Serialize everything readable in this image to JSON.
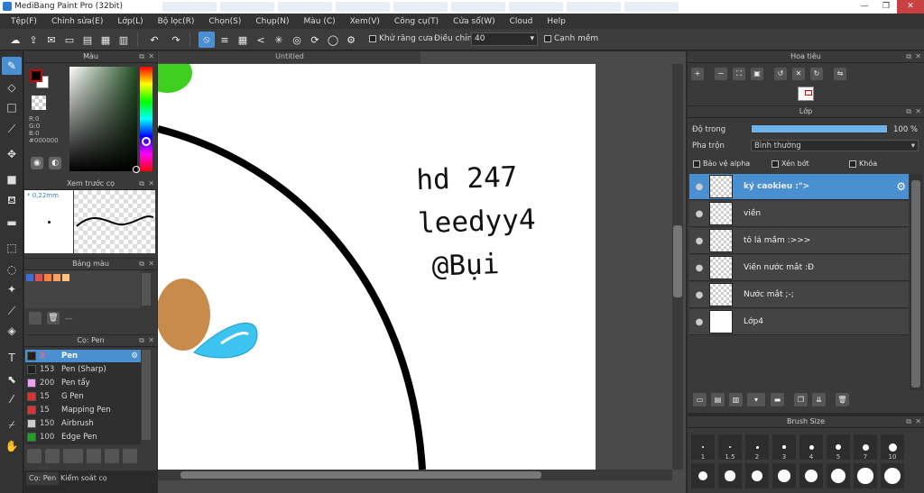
{
  "window": {
    "title": "MediBang Paint Pro (32bit)",
    "min": "—",
    "max": "❐",
    "close": "✕"
  },
  "menu": [
    "Tệp(F)",
    "Chỉnh sửa(E)",
    "Lớp(L)",
    "Bộ lọc(R)",
    "Chọn(S)",
    "Chụp(N)",
    "Màu (C)",
    "Xem(V)",
    "Công cụ(T)",
    "Cửa sổ(W)",
    "Cloud",
    "Help"
  ],
  "toolbar": {
    "antialias_label": "Khử răng cưa",
    "correction_label": "Điều chỉnh",
    "correction_value": "40",
    "edge_label": "Cạnh mềm"
  },
  "color_panel": {
    "title": "Màu",
    "r": "R:0",
    "g": "G:0",
    "b": "B:0",
    "hex": "#000000",
    "fg": "#000000",
    "bg": "#ffffff"
  },
  "brush_preview": {
    "title": "Xem trước cọ",
    "size": "* 0,22mm"
  },
  "palette": {
    "title": "Bảng màu",
    "swatches": [
      "#3b6fd6",
      "#e05050",
      "#ff7f3f",
      "#ff9f5f",
      "#ffc080"
    ],
    "dash": "---"
  },
  "brushes": {
    "title": "Cọ: Pen",
    "items": [
      {
        "size": "3",
        "name": "Pen",
        "color": "#202020"
      },
      {
        "size": "153",
        "name": "Pen (Sharp)",
        "color": "#202020"
      },
      {
        "size": "200",
        "name": "Pen tẩy",
        "color": "#f0a0f0"
      },
      {
        "size": "15",
        "name": "G Pen",
        "color": "#e03030"
      },
      {
        "size": "15",
        "name": "Mapping Pen",
        "color": "#e03030"
      },
      {
        "size": "150",
        "name": "Airbrush",
        "color": "#cccccc"
      },
      {
        "size": "100",
        "name": "Edge Pen",
        "color": "#20a020"
      }
    ]
  },
  "bottom_tabs": [
    "Cọ: Pen",
    "Kiểm soát cọ"
  ],
  "document": {
    "tab": "Untitled",
    "handwriting": [
      "hd 247",
      "leedyy4",
      "@Bụi"
    ]
  },
  "navigator": {
    "title": "Hoa tiêu"
  },
  "layers": {
    "title": "Lớp",
    "opacity_label": "Độ trong",
    "opacity_value": "100 %",
    "opacity_fraction": 1.0,
    "blend_label": "Pha trộn",
    "blend_value": "Bình thường",
    "protect_alpha": "Bảo vệ alpha",
    "clipping": "Xén bớt",
    "lock": "Khóa",
    "items": [
      {
        "name": "ký caokieu :\">",
        "selected": true
      },
      {
        "name": "viền",
        "selected": false
      },
      {
        "name": "tô lá mầm :>>>",
        "selected": false
      },
      {
        "name": "Viền nước mắt :Đ",
        "selected": false
      },
      {
        "name": "Nước mắt ;-;",
        "selected": false
      },
      {
        "name": "Lớp4",
        "selected": false
      }
    ]
  },
  "brush_size": {
    "title": "Brush Size",
    "labels": [
      "1",
      "1.5",
      "2",
      "3",
      "4",
      "5",
      "7",
      "10"
    ]
  }
}
